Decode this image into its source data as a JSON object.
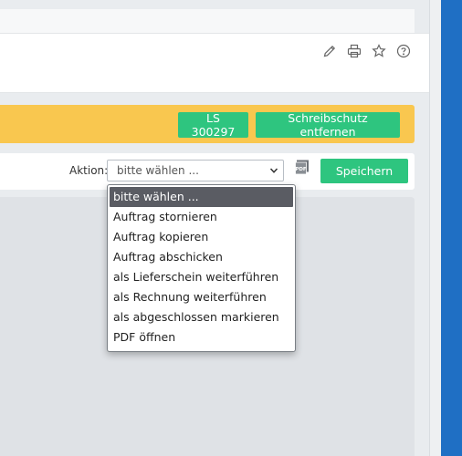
{
  "toolbar": {
    "edit_icon": "pencil-icon",
    "print_icon": "printer-icon",
    "favorite_icon": "star-icon",
    "help_icon": "question-circle-icon"
  },
  "status_bar": {
    "document_number": "LS 300297",
    "remove_protection_label": "Schreibschutz entfernen",
    "background_color": "#f9c74f",
    "button_color": "#2ec57f"
  },
  "action_row": {
    "label": "Aktion:",
    "selected_value": "bitte wählen ...",
    "pdf_icon": "pdf-icon",
    "save_label": "Speichern"
  },
  "dropdown": {
    "options": [
      "bitte wählen ...",
      "Auftrag stornieren",
      "Auftrag kopieren",
      "Auftrag abschicken",
      "als Lieferschein weiterführen",
      "als Rechnung weiterführen",
      "als abgeschlossen markieren",
      "PDF öffnen"
    ],
    "selected_index": 0
  }
}
